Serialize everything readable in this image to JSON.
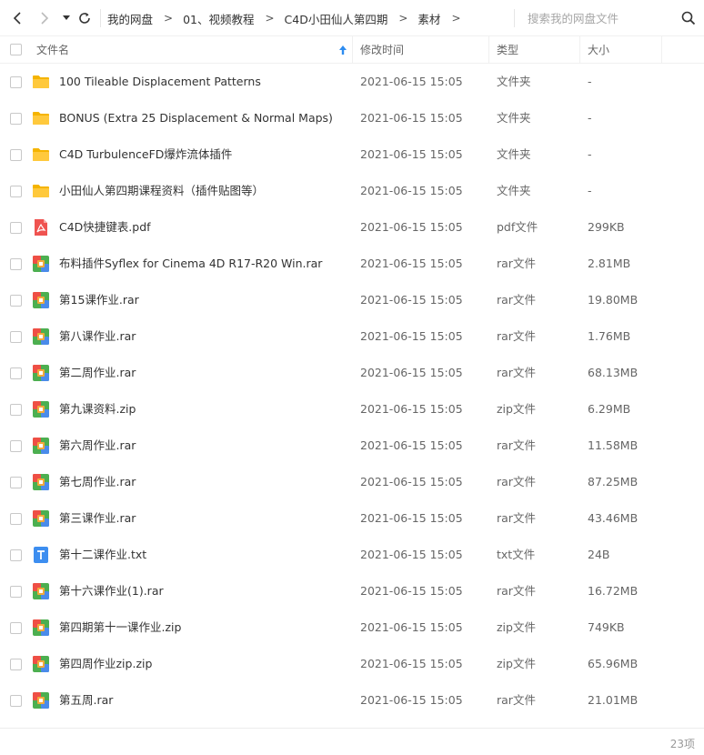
{
  "nav": {
    "back_icon": "chevron-left-icon",
    "forward_icon": "chevron-right-icon",
    "history_icon": "caret-down-icon",
    "refresh_icon": "refresh-icon"
  },
  "breadcrumb": [
    {
      "label": "我的网盘"
    },
    {
      "label": "01、视频教程"
    },
    {
      "label": "C4D小田仙人第四期"
    },
    {
      "label": "素材"
    }
  ],
  "breadcrumb_separator": ">",
  "search": {
    "placeholder": "搜索我的网盘文件",
    "value": "",
    "icon": "search-icon"
  },
  "columns": {
    "name": "文件名",
    "modified": "修改时间",
    "type": "类型",
    "size": "大小",
    "sort_icon": "sort-ascending-icon"
  },
  "files": [
    {
      "name": "100 Tileable Displacement Patterns",
      "modified": "2021-06-15 15:05",
      "type": "文件夹",
      "size": "-",
      "icon": "folder"
    },
    {
      "name": "BONUS (Extra 25 Displacement & Normal Maps)",
      "modified": "2021-06-15 15:05",
      "type": "文件夹",
      "size": "-",
      "icon": "folder"
    },
    {
      "name": "C4D TurbulenceFD爆炸流体插件",
      "modified": "2021-06-15 15:05",
      "type": "文件夹",
      "size": "-",
      "icon": "folder"
    },
    {
      "name": "小田仙人第四期课程资料（插件贴图等）",
      "modified": "2021-06-15 15:05",
      "type": "文件夹",
      "size": "-",
      "icon": "folder"
    },
    {
      "name": "C4D快捷键表.pdf",
      "modified": "2021-06-15 15:05",
      "type": "pdf文件",
      "size": "299KB",
      "icon": "pdf"
    },
    {
      "name": "布料插件Syflex for Cinema 4D R17-R20 Win.rar",
      "modified": "2021-06-15 15:05",
      "type": "rar文件",
      "size": "2.81MB",
      "icon": "archive"
    },
    {
      "name": "第15课作业.rar",
      "modified": "2021-06-15 15:05",
      "type": "rar文件",
      "size": "19.80MB",
      "icon": "archive"
    },
    {
      "name": "第八课作业.rar",
      "modified": "2021-06-15 15:05",
      "type": "rar文件",
      "size": "1.76MB",
      "icon": "archive"
    },
    {
      "name": "第二周作业.rar",
      "modified": "2021-06-15 15:05",
      "type": "rar文件",
      "size": "68.13MB",
      "icon": "archive"
    },
    {
      "name": "第九课资料.zip",
      "modified": "2021-06-15 15:05",
      "type": "zip文件",
      "size": "6.29MB",
      "icon": "archive"
    },
    {
      "name": "第六周作业.rar",
      "modified": "2021-06-15 15:05",
      "type": "rar文件",
      "size": "11.58MB",
      "icon": "archive"
    },
    {
      "name": "第七周作业.rar",
      "modified": "2021-06-15 15:05",
      "type": "rar文件",
      "size": "87.25MB",
      "icon": "archive"
    },
    {
      "name": "第三课作业.rar",
      "modified": "2021-06-15 15:05",
      "type": "rar文件",
      "size": "43.46MB",
      "icon": "archive"
    },
    {
      "name": "第十二课作业.txt",
      "modified": "2021-06-15 15:05",
      "type": "txt文件",
      "size": "24B",
      "icon": "text"
    },
    {
      "name": "第十六课作业(1).rar",
      "modified": "2021-06-15 15:05",
      "type": "rar文件",
      "size": "16.72MB",
      "icon": "archive"
    },
    {
      "name": "第四期第十一课作业.zip",
      "modified": "2021-06-15 15:05",
      "type": "zip文件",
      "size": "749KB",
      "icon": "archive"
    },
    {
      "name": "第四周作业zip.zip",
      "modified": "2021-06-15 15:05",
      "type": "zip文件",
      "size": "65.96MB",
      "icon": "archive"
    },
    {
      "name": "第五周.rar",
      "modified": "2021-06-15 15:05",
      "type": "rar文件",
      "size": "21.01MB",
      "icon": "archive"
    }
  ],
  "footer": {
    "item_count": "23项"
  },
  "colors": {
    "folder": "#ffc93c",
    "folder_tab": "#f5b400",
    "pdf": "#ef5350",
    "txt": "#3d8ef0",
    "archive_green": "#4caf50",
    "archive_red": "#ef4f45",
    "archive_orange": "#f2a93b",
    "archive_blue": "#4a8bea",
    "sort_arrow": "#2d8cf0"
  }
}
